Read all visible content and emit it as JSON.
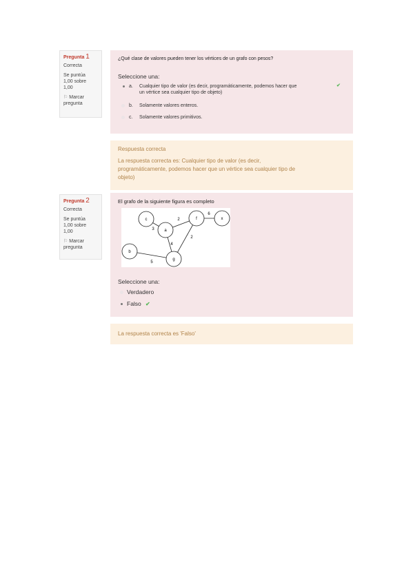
{
  "q1": {
    "info": {
      "label": "Pregunta",
      "number": "1",
      "state": "Correcta",
      "grade_line1": "Se puntúa",
      "grade_line2": "1,00 sobre",
      "grade_line3": "1,00",
      "flag_line1": "Marcar",
      "flag_line2": "pregunta"
    },
    "question": "¿Qué clase de valores pueden tener los vértices de un grafo con pesos?",
    "prompt": "Seleccione una:",
    "options": [
      {
        "letter": "a.",
        "line1": "Cualquier tipo de valor (es decir, programáticamente, podemos hacer que",
        "line2": "un vértice sea cualquier tipo de objeto)"
      },
      {
        "letter": "b.",
        "line1": "Solamente valores enteros."
      },
      {
        "letter": "c.",
        "line1": "Solamente valores primitivos."
      }
    ],
    "feedback": {
      "title": "Respuesta correcta",
      "line1": "La respuesta correcta es: Cualquier tipo de valor (es decir,",
      "line2": "programáticamente, podemos hacer que un vértice sea cualquier tipo de",
      "line3": "objeto)"
    }
  },
  "q2": {
    "info": {
      "label": "Pregunta",
      "number": "2",
      "state": "Correcta",
      "grade_line1": "Se puntúa",
      "grade_line2": "1,00 sobre",
      "grade_line3": "1,00",
      "flag_line1": "Marcar",
      "flag_line2": "pregunta"
    },
    "question": "El grafo de la siguiente figura es completo",
    "graph": {
      "nodes": [
        "c",
        "a",
        "f",
        "x",
        "b",
        "g"
      ],
      "weights": [
        "3",
        "2",
        "6",
        "4",
        "2",
        "5"
      ]
    },
    "prompt": "Seleccione una:",
    "options": [
      {
        "label": "Verdadero"
      },
      {
        "label": "Falso"
      }
    ],
    "feedback": {
      "text": "La respuesta correcta es 'Falso'"
    }
  },
  "icons": {
    "check": "checkmark-icon",
    "flag": "flag-icon",
    "check_color": "#5cb85c"
  }
}
